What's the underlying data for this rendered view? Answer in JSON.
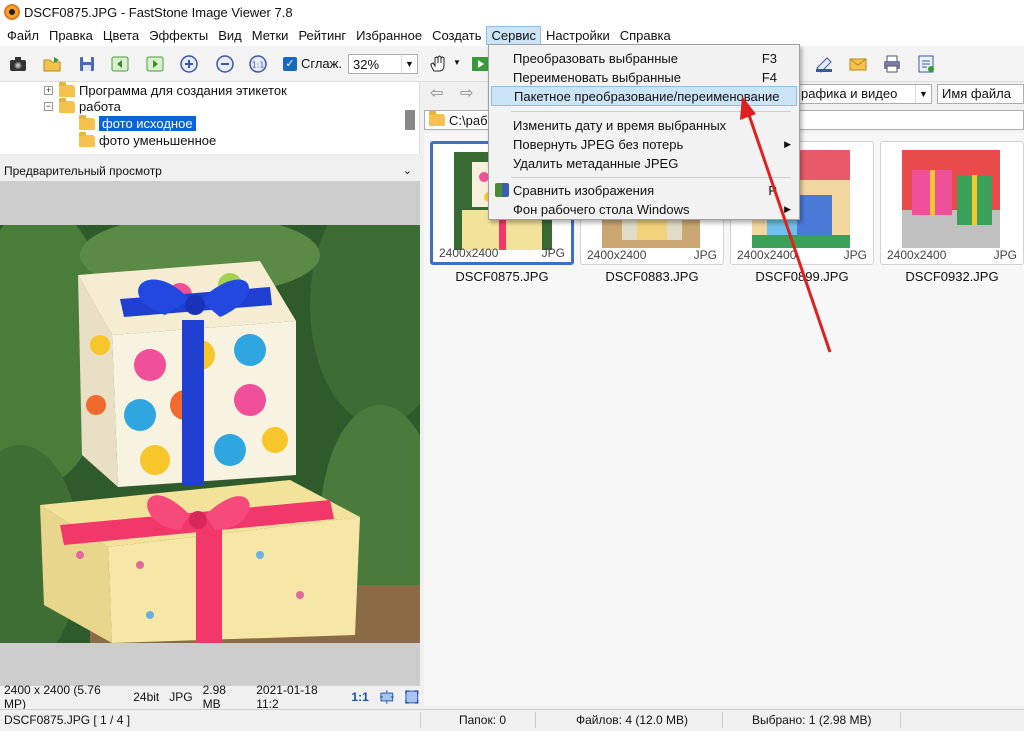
{
  "window": {
    "title": "DSCF0875.JPG - FastStone Image Viewer 7.8"
  },
  "menu": [
    "Файл",
    "Правка",
    "Цвета",
    "Эффекты",
    "Вид",
    "Метки",
    "Рейтинг",
    "Избранное",
    "Создать",
    "Сервис",
    "Настройки",
    "Справка"
  ],
  "toolbar": {
    "smooth_label": "Сглаж.",
    "zoom_value": "32%"
  },
  "tree": {
    "items": [
      {
        "label": "Программа для создания этикеток"
      },
      {
        "label": "работа"
      },
      {
        "label": "фото исходное"
      },
      {
        "label": "фото уменьшенное"
      }
    ]
  },
  "preview": {
    "header": "Предварительный просмотр"
  },
  "info": {
    "dims": "2400 x 2400 (5.76 MP)",
    "depth": "24bit",
    "format": "JPG",
    "size": "2.98 MB",
    "date": "2021-01-18 11:2",
    "ratio": "1:1"
  },
  "browser": {
    "filter": "рафика и видео",
    "sort": "Имя файла",
    "path": "C:\\рабо",
    "thumbs": [
      {
        "res": "2400x2400",
        "fmt": "JPG",
        "name": "DSCF0875.JPG"
      },
      {
        "res": "2400x2400",
        "fmt": "JPG",
        "name": "DSCF0883.JPG"
      },
      {
        "res": "2400x2400",
        "fmt": "JPG",
        "name": "DSCF0899.JPG"
      },
      {
        "res": "2400x2400",
        "fmt": "JPG",
        "name": "DSCF0932.JPG"
      }
    ]
  },
  "dropdown": {
    "items": [
      {
        "label": "Преобразовать выбранные",
        "shortcut": "F3"
      },
      {
        "label": "Переименовать выбранные",
        "shortcut": "F4"
      },
      {
        "label": "Пакетное преобразование/переименование",
        "shortcut": ""
      },
      {
        "label": "Изменить дату и время выбранных",
        "shortcut": ""
      },
      {
        "label": "Повернуть JPEG без потерь",
        "shortcut": ""
      },
      {
        "label": "Удалить метаданные JPEG",
        "shortcut": ""
      },
      {
        "label": "Сравнить изображения",
        "shortcut": "P"
      },
      {
        "label": "Фон рабочего стола Windows",
        "shortcut": ""
      }
    ]
  },
  "status": {
    "file": "DSCF0875.JPG [ 1 / 4 ]",
    "folders": "Папок: 0",
    "files": "Файлов: 4 (12.0 MB)",
    "selected": "Выбрано: 1 (2.98 MB)"
  },
  "colors": {
    "accent": "#0a64d8",
    "menu_highlight": "#cce4f7",
    "annotation_arrow": "#e02020",
    "thumb_selected_border": "#3d6fc2"
  }
}
